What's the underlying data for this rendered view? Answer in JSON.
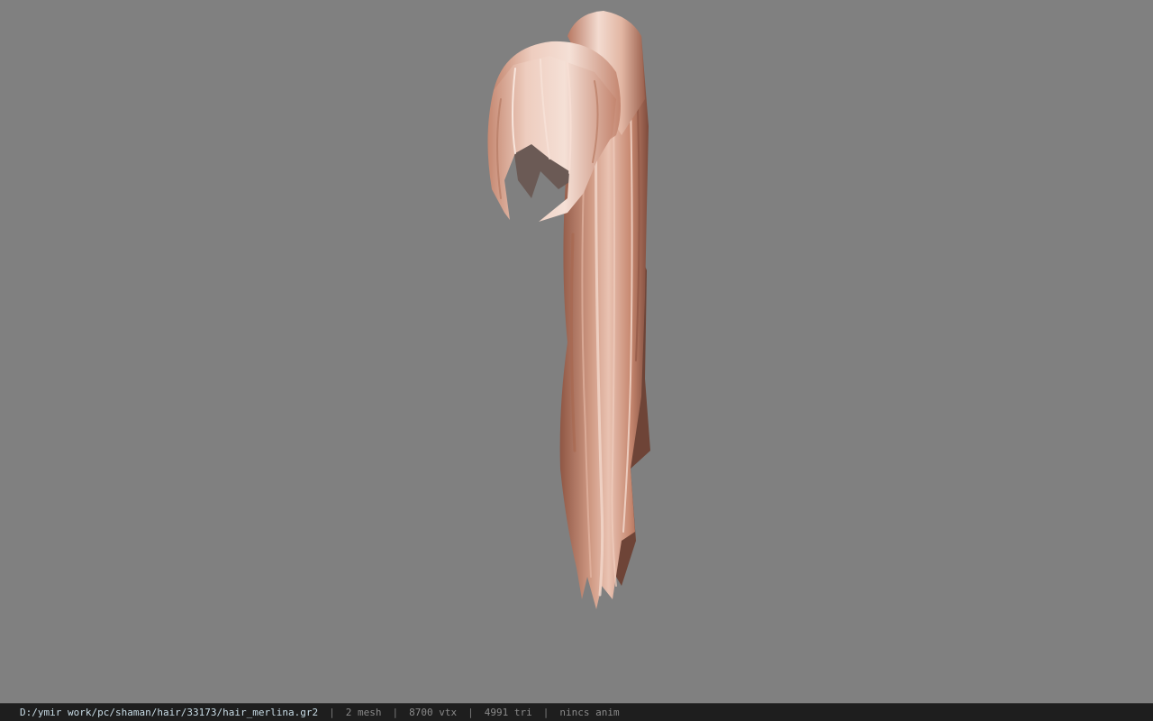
{
  "viewer": {
    "background_color": "#808080",
    "model": {
      "icon": "hair-ponytail-mesh",
      "base_color": "#c98a72",
      "highlight_color": "#f1d3c6",
      "shadow_color": "#7a4a3c"
    }
  },
  "statusbar": {
    "file_path": "D:/ymir work/pc/shaman/hair/33173/hair_merlina.gr2",
    "separator": "|",
    "mesh_count": "2 mesh",
    "vertex_count": "8700 vtx",
    "triangle_count": "4991 tri",
    "anim": "nincs anim"
  }
}
